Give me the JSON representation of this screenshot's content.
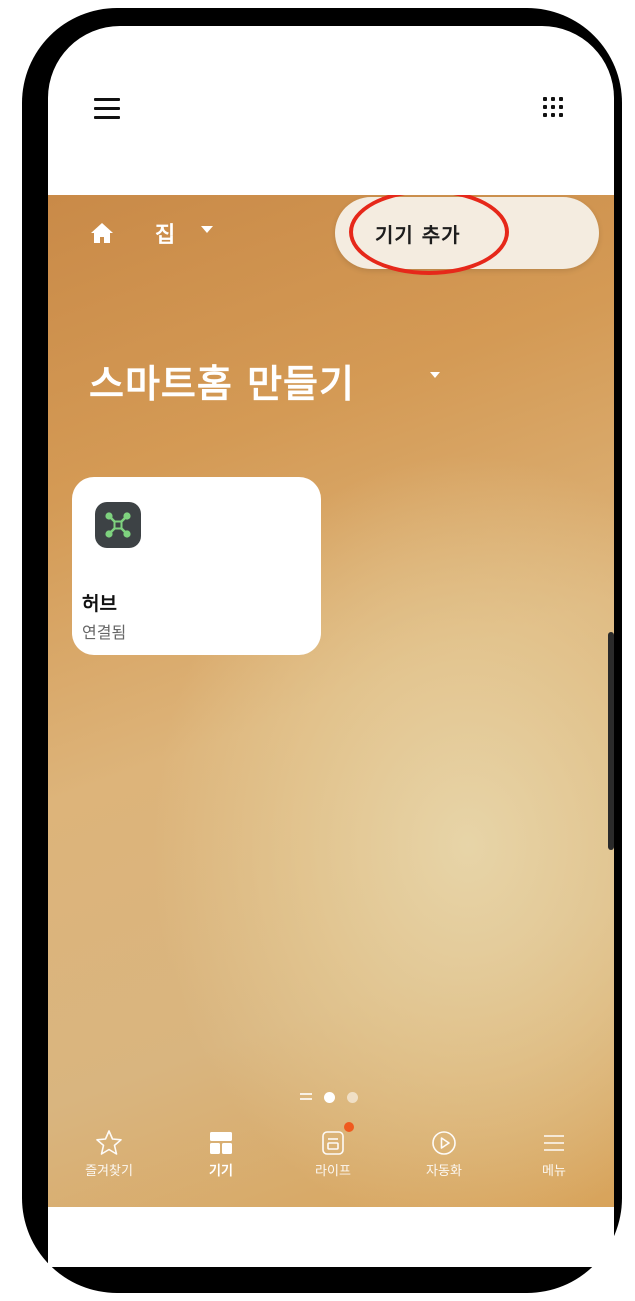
{
  "header": {
    "location_label": "집",
    "add_device_label": "기기 추가"
  },
  "main": {
    "title": "스마트홈 만들기",
    "devices": [
      {
        "name": "허브",
        "status": "연결됨"
      }
    ],
    "pager": {
      "current_page": 1,
      "total_pages": 2
    }
  },
  "nav": {
    "items": [
      {
        "label": "즐겨찾기",
        "icon": "star-icon"
      },
      {
        "label": "기기",
        "icon": "devices-icon",
        "active": true
      },
      {
        "label": "라이프",
        "icon": "life-icon",
        "badge": true
      },
      {
        "label": "자동화",
        "icon": "play-icon"
      },
      {
        "label": "메뉴",
        "icon": "menu-icon"
      }
    ]
  },
  "colors": {
    "accent_red": "#e6281a",
    "badge_orange": "#f05a1e",
    "hub_icon_green": "#7ed27e"
  }
}
